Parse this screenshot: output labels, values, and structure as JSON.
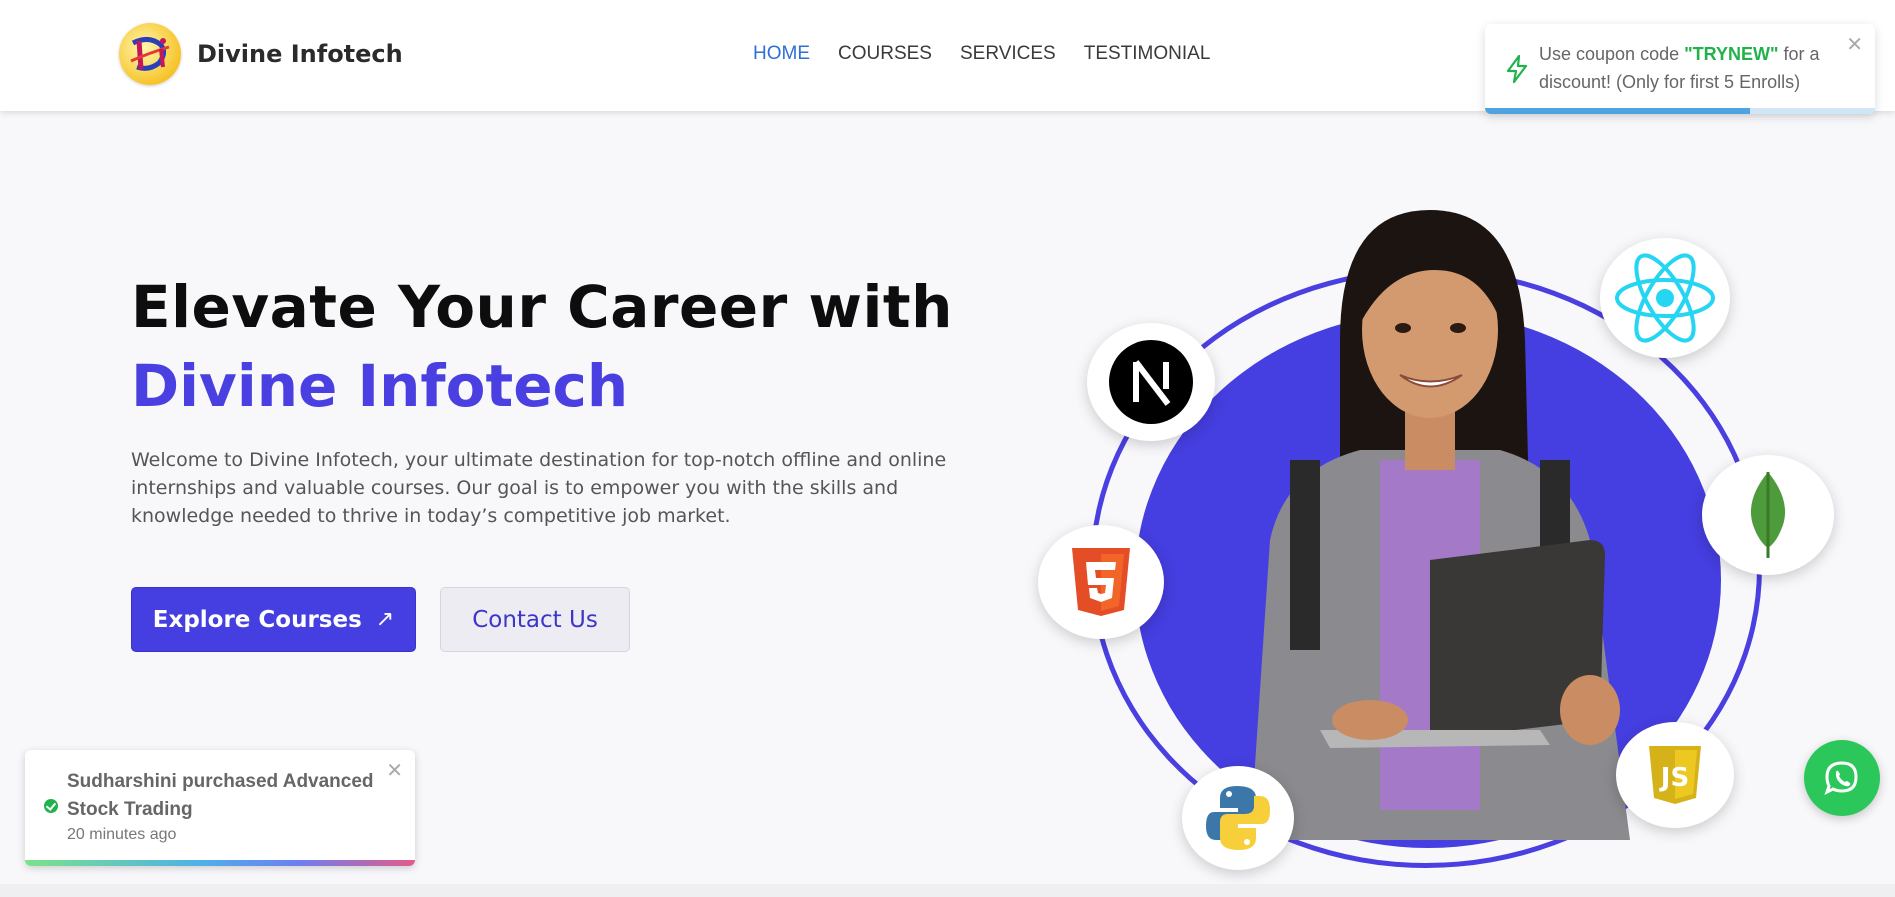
{
  "header": {
    "brand": "Divine Infotech",
    "nav": [
      {
        "label": "HOME",
        "active": true
      },
      {
        "label": "COURSES",
        "active": false
      },
      {
        "label": "SERVICES",
        "active": false
      },
      {
        "label": "TESTIMONIAL",
        "active": false
      }
    ]
  },
  "coupon_toast": {
    "prefix": "Use coupon code ",
    "code": "\"TRYNEW\"",
    "suffix": " for a discount! (Only for first 5 Enrolls)",
    "close": "✕",
    "progress": 0.68,
    "icon": "bolt-icon"
  },
  "hero": {
    "title_line1": "Elevate Your Career with",
    "title_line2": "Divine Infotech",
    "description": "Welcome to Divine Infotech, your ultimate destination for top-notch offline and online internships and valuable courses. Our goal is to empower you with the skills and knowledge needed to thrive in today’s competitive job market.",
    "primary_button": "Explore Courses",
    "primary_button_icon": "↗",
    "secondary_button": "Contact Us"
  },
  "tech_icons": [
    "nextjs-icon",
    "react-icon",
    "mongodb-icon",
    "html5-icon",
    "javascript-icon",
    "python-icon"
  ],
  "purchase_toast": {
    "message": "Sudharshini purchased Advanced Stock Trading",
    "time": "20 minutes ago",
    "close": "✕"
  },
  "colors": {
    "accent": "#453ee0",
    "nav_active": "#2f6fd6",
    "coupon_code": "#22b24c",
    "whatsapp": "#2bc75a"
  }
}
